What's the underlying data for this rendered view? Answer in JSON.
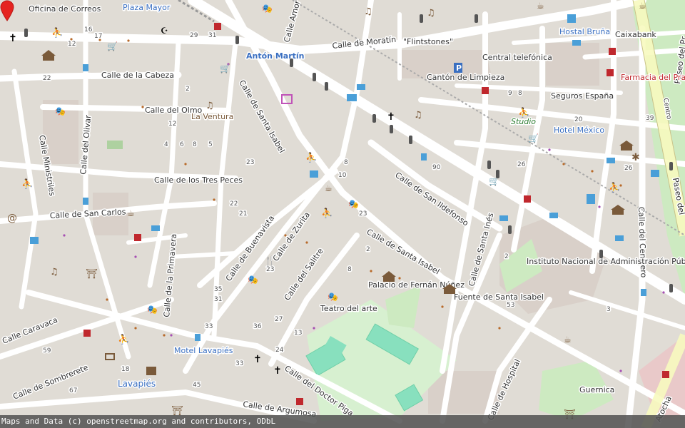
{
  "map": {
    "attribution": "Maps and Data (c) openstreetmap.org and contributors, ODbL",
    "colors": {
      "background": "#e0dcd5",
      "road": "#ffffff",
      "main_road": "#f7fabf",
      "park": "#cdeac1",
      "pitch": "#88e0be",
      "marker": "#e52420"
    },
    "streets": {
      "calle_amor": "Calle Amor d",
      "calle_moratin": "Calle de Moratín",
      "calle_cabeza": "Calle de la Cabeza",
      "calle_olmo": "Calle del Olmo",
      "calle_santa_isabel_north": "Calle de Santa Isabel",
      "calle_tres_peces": "Calle de los Tres Peces",
      "calle_san_carlos": "Calle de San Carlos",
      "calle_olivar": "Calle del Olivar",
      "calle_ministriles": "Calle Ministriles",
      "calle_buenavista": "Calle de Buenavista",
      "calle_zurita": "Calle de Zurita",
      "calle_primavera": "Calle de la Primavera",
      "calle_salitre": "Calle del Salitre",
      "calle_san_ildefonso": "Calle de San Ildefonso",
      "calle_santa_ines": "Calle de Santa Inés",
      "calle_santa_isabel_south": "Calle de Santa Isabel",
      "calle_caravaca": "Calle Caravaca",
      "calle_sombrerete": "Calle de Sombrerete",
      "calle_doctor_piga": "Calle del Doctor Piga",
      "calle_argumosa": "Calle de Argumosa",
      "calle_hospital": "Calle de Hospital",
      "calle_cenicero": "Calle del Cenicero",
      "paseo_prado": "Paseo del Pr",
      "paseo_del": "Paseo del",
      "centro": "Centro",
      "calle_atocha": "Atocha"
    },
    "places": {
      "oficina_correos": "Oficina de Correos",
      "plaza_mayor": "Plaza Mayor",
      "anton_martin": "Antón Martín",
      "flintstones": "\"Flintstones\"",
      "central_telefonica": "Central telefónica",
      "canton_limpieza": "Cantón de Limpieza",
      "hostal_bruna": "Hostal Bruña",
      "caixabank": "Caixabank",
      "farmacia_prado": "Farmacia del Prado",
      "seguros_espana": "Seguros España",
      "studio": "Studio",
      "hotel_mexico": "Hotel México",
      "la_ventura": "La Ventura",
      "instituto": "Instituto Nacional de Administración Pública",
      "palacio": "Palacio de Fernán Núñez",
      "teatro": "Teatro del arte",
      "fuente": "Fuente de Santa Isabel",
      "motel_lavapies": "Motel Lavapiés",
      "lavapies": "Lavapiés",
      "guernica": "Guernica"
    },
    "icons": [
      "cross-icon",
      "hospital-icon",
      "theatre-icon",
      "music-icon",
      "bus-stop-icon",
      "bed-icon",
      "parking-icon",
      "cafe-icon",
      "fuel-icon",
      "dentist-icon",
      "church-icon",
      "museum-icon",
      "marker-icon",
      "police-icon",
      "ice-cream-icon",
      "gym-icon",
      "shopping-icon",
      "bicycle-icon",
      "fountain-icon"
    ]
  }
}
